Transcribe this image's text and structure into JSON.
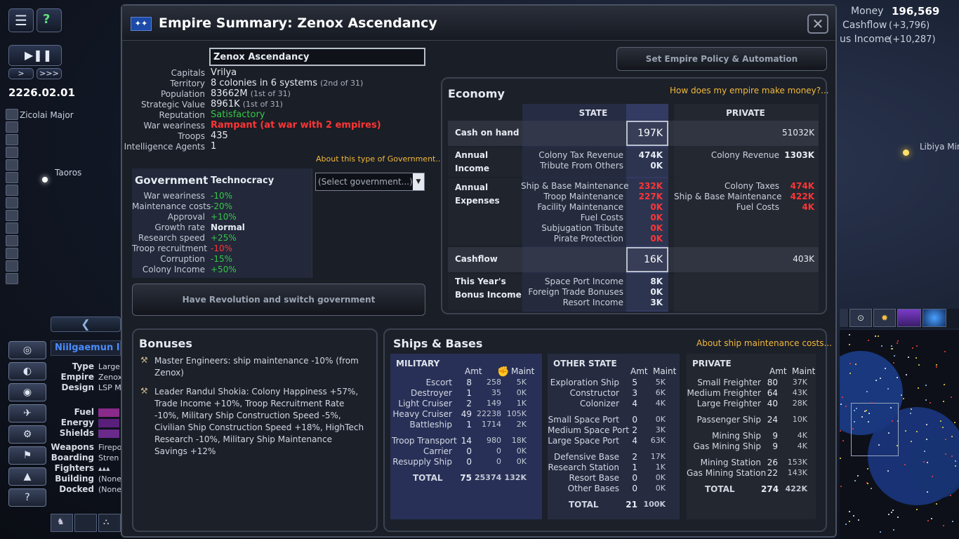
{
  "hud": {
    "date": "2226.02.01",
    "speed_slow": ">",
    "speed_fast": ">>>",
    "money_label": "Money",
    "money_value": "196,569",
    "cashflow_label": "Cashflow",
    "cashflow_value": "(+3,796)",
    "bonus_label": "us Income",
    "bonus_value": "(+10,287)",
    "map_labels": [
      "Zicolai Major",
      "Taoros",
      "Libiya Minc"
    ]
  },
  "selected": {
    "name": "Niilgaemun I S",
    "fields": [
      {
        "key": "Type",
        "value": "Large"
      },
      {
        "key": "Empire",
        "value": "Zenox"
      },
      {
        "key": "Design",
        "value": "LSP M"
      },
      {
        "key": "Fuel",
        "value": ""
      },
      {
        "key": "Energy",
        "value": ""
      },
      {
        "key": "Shields",
        "value": ""
      },
      {
        "key": "Weapons",
        "value": "Firepo"
      },
      {
        "key": "Boarding",
        "value": "Stren"
      },
      {
        "key": "Fighters",
        "value": ""
      },
      {
        "key": "Building",
        "value": "(None"
      },
      {
        "key": "Docked",
        "value": "(None"
      }
    ]
  },
  "window": {
    "title": "Empire Summary: Zenox Ascendancy",
    "close": "✕"
  },
  "overview": {
    "name_input": "Zenox Ascendancy",
    "policy_button": "Set Empire Policy & Automation",
    "capitals_label": "Capitals",
    "capitals": "Vrilya",
    "territory_label": "Territory",
    "territory": "8 colonies in 6 systems",
    "territory_rank": "(2nd of 31)",
    "population_label": "Population",
    "population": "83662M",
    "population_rank": "(1st of 31)",
    "strategic_label": "Strategic Value",
    "strategic": "8961K",
    "strategic_rank": "(1st of 31)",
    "reputation_label": "Reputation",
    "reputation": "Satisfactory",
    "war_label": "War weariness",
    "war": "Rampant (at war with 2 empires)",
    "troops_label": "Troops",
    "troops": "435",
    "agents_label": "Intelligence Agents",
    "agents": "1",
    "about_gov": "About this type of Government..."
  },
  "government": {
    "title": "Government",
    "type": "Technocracy",
    "select_placeholder": "(Select government...)",
    "revolution_button": "Have Revolution and switch government",
    "rows": [
      {
        "label": "War weariness",
        "value": "-10%",
        "color": "green"
      },
      {
        "label": "Maintenance costs",
        "value": "-20%",
        "color": "green"
      },
      {
        "label": "Approval",
        "value": "+10%",
        "color": "green"
      },
      {
        "label": "Growth rate",
        "value": "Normal",
        "color": "white"
      },
      {
        "label": "Research speed",
        "value": "+25%",
        "color": "green"
      },
      {
        "label": "Troop recruitment",
        "value": "-10%",
        "color": "red"
      },
      {
        "label": "Corruption",
        "value": "-15%",
        "color": "green"
      },
      {
        "label": "Colony Income",
        "value": "+50%",
        "color": "green"
      }
    ]
  },
  "economy": {
    "title": "Economy",
    "help_link": "How does my empire make money?...",
    "state_header": "STATE",
    "private_header": "PRIVATE",
    "cash_label": "Cash on hand",
    "cash_state": "197K",
    "cash_private": "51032K",
    "income_label": "Annual Income",
    "income_state": [
      {
        "name": "Colony Tax Revenue",
        "value": "474K"
      },
      {
        "name": "Tribute From Others",
        "value": "0K"
      }
    ],
    "income_private": [
      {
        "name": "Colony Revenue",
        "value": "1303K"
      }
    ],
    "expenses_label": "Annual Expenses",
    "expenses_state": [
      {
        "name": "Ship & Base Maintenance",
        "value": "232K"
      },
      {
        "name": "Troop Maintenance",
        "value": "227K"
      },
      {
        "name": "Facility Maintenance",
        "value": "0K"
      },
      {
        "name": "Fuel Costs",
        "value": "0K"
      },
      {
        "name": "Subjugation Tribute",
        "value": "0K"
      },
      {
        "name": "Pirate Protection",
        "value": "0K"
      }
    ],
    "expenses_private": [
      {
        "name": "Colony Taxes",
        "value": "474K"
      },
      {
        "name": "Ship & Base Maintenance",
        "value": "422K"
      },
      {
        "name": "Fuel Costs",
        "value": "4K"
      }
    ],
    "cashflow_label": "Cashflow",
    "cashflow_state": "16K",
    "cashflow_private": "403K",
    "bonus_label": "This Year's Bonus Income",
    "bonus_state": [
      {
        "name": "Space Port Income",
        "value": "8K"
      },
      {
        "name": "Foreign Trade Bonuses",
        "value": "0K"
      },
      {
        "name": "Resort Income",
        "value": "3K"
      }
    ]
  },
  "bonuses": {
    "title": "Bonuses",
    "items": [
      "Master Engineers: ship maintenance -10% (from Zenox)",
      "Leader Randul Shokia: Colony Happiness +57%, Trade Income +10%, Troop Recruitment Rate -10%, Military Ship Construction Speed -5%, Civilian Ship Construction Speed +18%, HighTech Research -10%, Military Ship Maintenance Savings +12%"
    ]
  },
  "ships": {
    "title": "Ships & Bases",
    "maint_link": "About ship maintenance costs...",
    "amt_header": "Amt",
    "maint_header": "Maint",
    "military": {
      "title": "MILITARY",
      "rows": [
        {
          "name": "Escort",
          "amt": "8",
          "str": "258",
          "maint": "5K"
        },
        {
          "name": "Destroyer",
          "amt": "1",
          "str": "35",
          "maint": "0K"
        },
        {
          "name": "Light Cruiser",
          "amt": "2",
          "str": "149",
          "maint": "1K"
        },
        {
          "name": "Heavy Cruiser",
          "amt": "49",
          "str": "22238",
          "maint": "105K"
        },
        {
          "name": "Battleship",
          "amt": "1",
          "str": "1714",
          "maint": "2K"
        },
        {
          "name": "Troop Transport",
          "amt": "14",
          "str": "980",
          "maint": "18K"
        },
        {
          "name": "Carrier",
          "amt": "0",
          "str": "0",
          "maint": "0K"
        },
        {
          "name": "Resupply Ship",
          "amt": "0",
          "str": "0",
          "maint": "0K"
        }
      ],
      "total_label": "TOTAL",
      "total_amt": "75",
      "total_str": "25374",
      "total_maint": "132K"
    },
    "other": {
      "title": "OTHER STATE",
      "rows": [
        {
          "name": "Exploration Ship",
          "amt": "5",
          "maint": "5K"
        },
        {
          "name": "Constructor",
          "amt": "3",
          "maint": "6K"
        },
        {
          "name": "Colonizer",
          "amt": "4",
          "maint": "4K"
        },
        {
          "name": "Small Space Port",
          "amt": "0",
          "maint": "0K"
        },
        {
          "name": "Medium Space Port",
          "amt": "2",
          "maint": "3K"
        },
        {
          "name": "Large Space Port",
          "amt": "4",
          "maint": "63K"
        },
        {
          "name": "Defensive Base",
          "amt": "2",
          "maint": "17K"
        },
        {
          "name": "Research Station",
          "amt": "1",
          "maint": "1K"
        },
        {
          "name": "Resort Base",
          "amt": "0",
          "maint": "0K"
        },
        {
          "name": "Other Bases",
          "amt": "0",
          "maint": "0K"
        }
      ],
      "total_label": "TOTAL",
      "total_amt": "21",
      "total_maint": "100K"
    },
    "private": {
      "title": "PRIVATE",
      "rows": [
        {
          "name": "Small Freighter",
          "amt": "80",
          "maint": "37K"
        },
        {
          "name": "Medium Freighter",
          "amt": "64",
          "maint": "43K"
        },
        {
          "name": "Large Freighter",
          "amt": "40",
          "maint": "28K"
        },
        {
          "name": "Passenger Ship",
          "amt": "24",
          "maint": "10K"
        },
        {
          "name": "Mining Ship",
          "amt": "9",
          "maint": "4K"
        },
        {
          "name": "Gas Mining Ship",
          "amt": "9",
          "maint": "4K"
        },
        {
          "name": "Mining Station",
          "amt": "26",
          "maint": "153K"
        },
        {
          "name": "Gas Mining Station",
          "amt": "22",
          "maint": "143K"
        }
      ],
      "total_label": "TOTAL",
      "total_amt": "274",
      "total_maint": "422K"
    }
  }
}
